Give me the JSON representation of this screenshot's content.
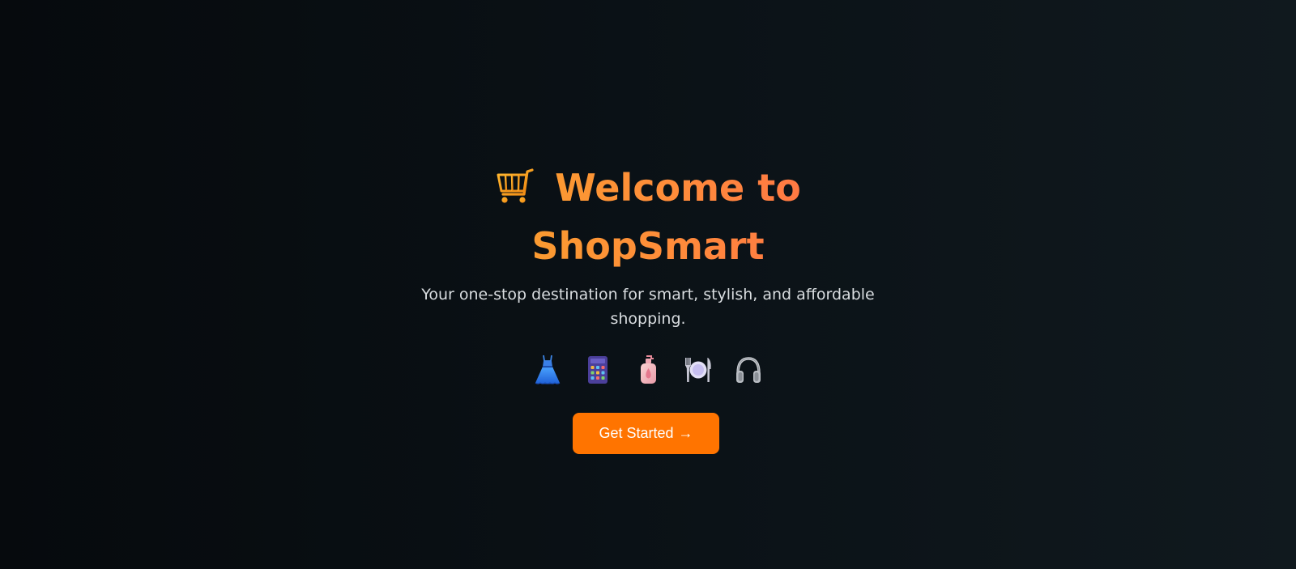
{
  "hero": {
    "title_line1": "Welcome to",
    "title_line2": "ShopSmart",
    "subtitle": "Your one-stop destination for smart, stylish, and affordable shopping.",
    "cta_label": "Get Started",
    "cta_arrow": "→",
    "categories": [
      {
        "icon": "dress-icon"
      },
      {
        "icon": "calculator-icon"
      },
      {
        "icon": "lotion-bottle-icon"
      },
      {
        "icon": "plate-cutlery-icon"
      },
      {
        "icon": "headphones-icon"
      }
    ]
  },
  "colors": {
    "background": "#0b1217",
    "title_gradient_start": "#f7a828",
    "title_gradient_end": "#ff6b4a",
    "subtitle": "#d9dde0",
    "cta_background": "#ff7400",
    "cta_text": "#ffffff"
  }
}
